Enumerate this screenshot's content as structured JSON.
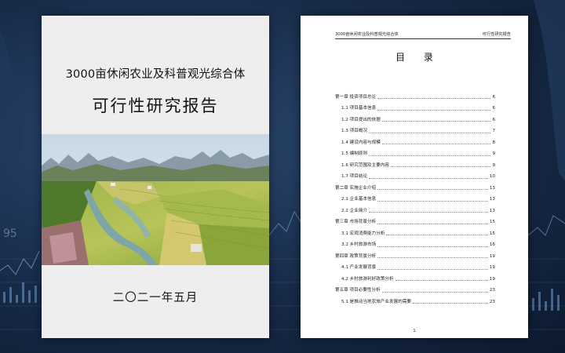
{
  "cover": {
    "title": "3000亩休闲农业及科普观光综合体",
    "subtitle": "可行性研究报告",
    "date": "二〇二一年五月"
  },
  "toc_page": {
    "running_header_left": "3000亩休闲农业及科普观光综合体",
    "running_header_right": "可行性研究报告",
    "heading": "目 录",
    "page_number": "1",
    "entries": [
      {
        "label": "第一章  投资项目总论",
        "page": "6",
        "level": 1
      },
      {
        "label": "1.1 项目基本信息",
        "page": "6",
        "level": 2
      },
      {
        "label": "1.2 项目提出的依据",
        "page": "6",
        "level": 2
      },
      {
        "label": "1.3 项目概况",
        "page": "7",
        "level": 2
      },
      {
        "label": "1.4 建设内容与规模",
        "page": "8",
        "level": 2
      },
      {
        "label": "1.5 编制原则",
        "page": "9",
        "level": 2
      },
      {
        "label": "1.6 研究范围及主要内容",
        "page": "9",
        "level": 2
      },
      {
        "label": "1.7 项目结论",
        "page": "10",
        "level": 2
      },
      {
        "label": "第二章  实施企业介绍",
        "page": "13",
        "level": 1
      },
      {
        "label": "2.1 企业基本信息",
        "page": "13",
        "level": 2
      },
      {
        "label": "2.2 企业简介",
        "page": "13",
        "level": 2
      },
      {
        "label": "第三章  市场背景分析",
        "page": "15",
        "level": 1
      },
      {
        "label": "3.1 宏观消费能力分析",
        "page": "15",
        "level": 2
      },
      {
        "label": "3.2 乡村旅游市场",
        "page": "16",
        "level": 2
      },
      {
        "label": "第四章  政策背景分析",
        "page": "19",
        "level": 1
      },
      {
        "label": "4.1 产业发展背景",
        "page": "19",
        "level": 2
      },
      {
        "label": "4.2 乡村旅游利好政策分析",
        "page": "19",
        "level": 2
      },
      {
        "label": "第五章  项目必要性分析",
        "page": "23",
        "level": 1
      },
      {
        "label": "5.1 是推动当地农旅产业发展的需要",
        "page": "23",
        "level": 2
      }
    ]
  },
  "background": {
    "ticker_text": "95"
  }
}
